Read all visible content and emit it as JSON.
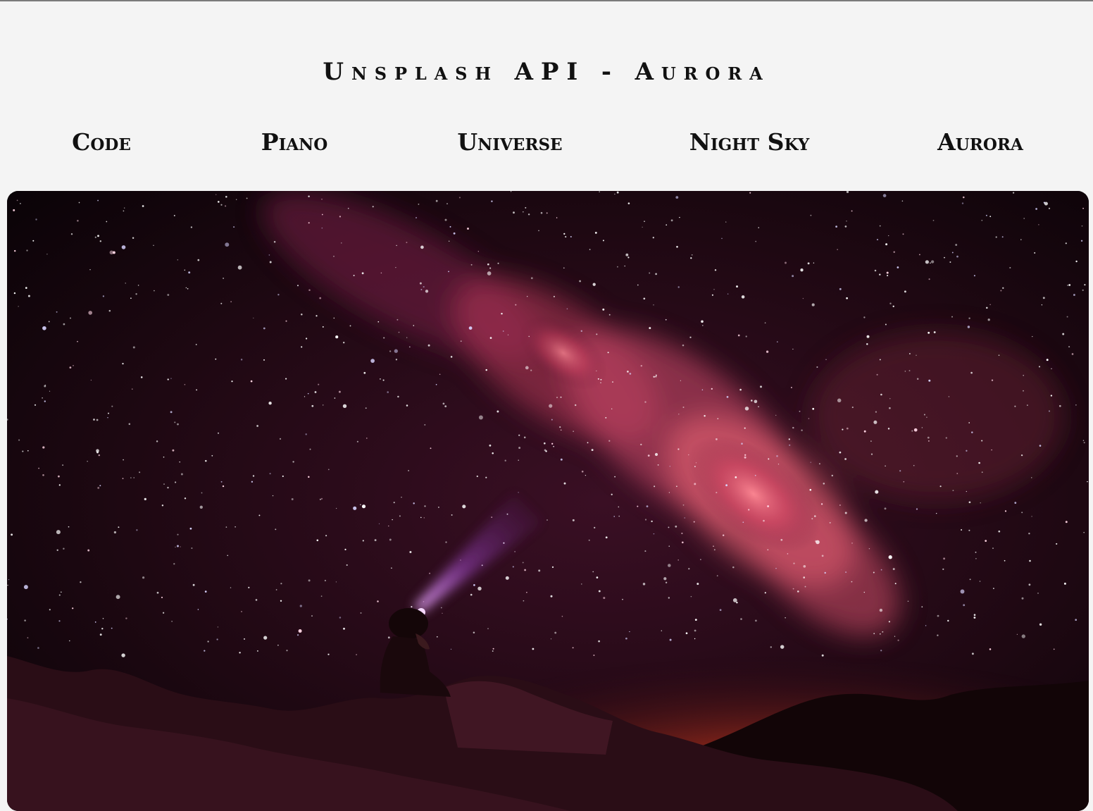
{
  "page": {
    "title": "Unsplash API - Aurora"
  },
  "nav": {
    "items": [
      {
        "label": "Code"
      },
      {
        "label": "Piano"
      },
      {
        "label": "Universe"
      },
      {
        "label": "Night Sky"
      },
      {
        "label": "Aurora"
      }
    ]
  },
  "photo": {
    "subject": "night-sky-milky-way-photo",
    "colors": {
      "sky_dark": "#0b0307",
      "galaxy_core": "#ff6a78",
      "glow_horizon": "#ff5a12",
      "headlamp": "#d070ff"
    }
  }
}
